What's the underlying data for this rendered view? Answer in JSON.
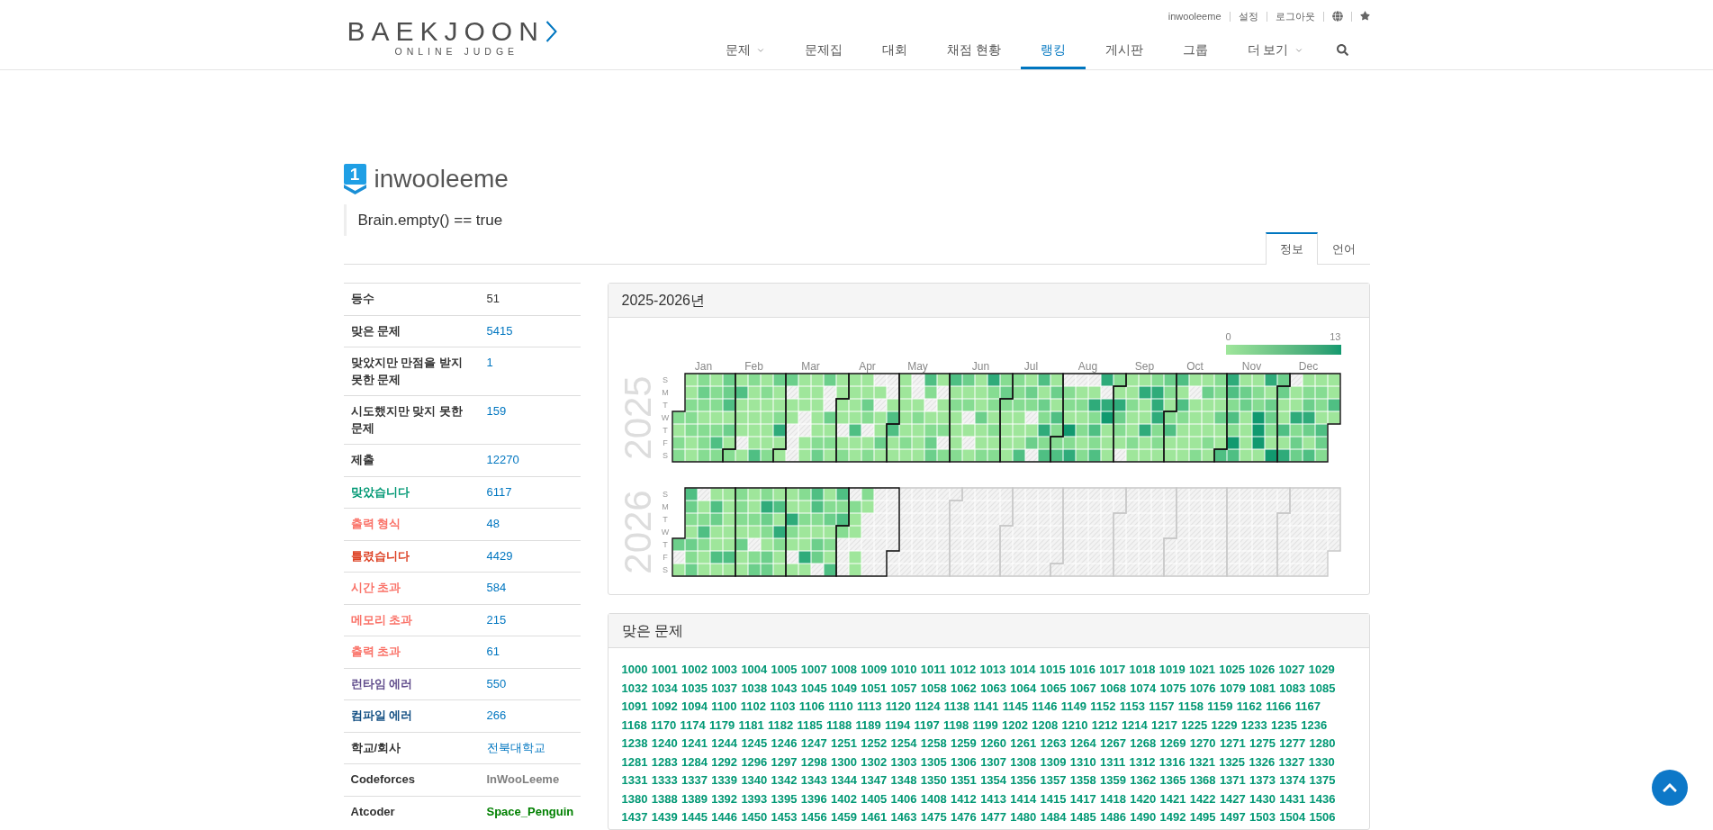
{
  "header": {
    "logo": {
      "wordmark": "BAEKJOON",
      "tagline": "ONLINE JUDGE"
    },
    "user_links": [
      "inwooleeme",
      "설정",
      "로그아웃"
    ],
    "nav": [
      {
        "label": "문제",
        "dropdown": true,
        "selected": false
      },
      {
        "label": "문제집",
        "dropdown": false,
        "selected": false
      },
      {
        "label": "대회",
        "dropdown": false,
        "selected": false
      },
      {
        "label": "채점 현황",
        "dropdown": false,
        "selected": false
      },
      {
        "label": "랭킹",
        "dropdown": false,
        "selected": true
      },
      {
        "label": "게시판",
        "dropdown": false,
        "selected": false
      },
      {
        "label": "그룹",
        "dropdown": false,
        "selected": false
      },
      {
        "label": "더 보기",
        "dropdown": true,
        "selected": false
      }
    ]
  },
  "profile": {
    "rank_badge": "1",
    "username": "inwooleeme",
    "status_message": "Brain.empty() == true",
    "tabs": [
      {
        "label": "정보",
        "selected": true
      },
      {
        "label": "언어",
        "selected": false
      }
    ]
  },
  "stats": [
    {
      "label": {
        "text": "등수",
        "color": "#333333"
      },
      "value": {
        "text": "51",
        "color": "#333333"
      },
      "kind": "plain"
    },
    {
      "label": {
        "text": "맞은 문제",
        "color": "#333333"
      },
      "value": {
        "text": "5415",
        "color": "#0076c0"
      },
      "kind": "link"
    },
    {
      "label": {
        "text": "맞았지만 만점을 받지 못한 문제",
        "color": "#333333"
      },
      "value": {
        "text": "1",
        "color": "#0076c0"
      },
      "kind": "link"
    },
    {
      "label": {
        "text": "시도했지만 맞지 못한 문제",
        "color": "#333333"
      },
      "value": {
        "text": "159",
        "color": "#0076c0"
      },
      "kind": "link"
    },
    {
      "label": {
        "text": "제출",
        "color": "#333333"
      },
      "value": {
        "text": "12270",
        "color": "#0076c0"
      },
      "kind": "link"
    },
    {
      "label": {
        "text": "맞았습니다",
        "color": "#009874"
      },
      "value": {
        "text": "6117",
        "color": "#0076c0"
      },
      "kind": "link"
    },
    {
      "label": {
        "text": "출력 형식",
        "color": "#fa7268"
      },
      "value": {
        "text": "48",
        "color": "#0076c0"
      },
      "kind": "link"
    },
    {
      "label": {
        "text": "틀렸습니다",
        "color": "#dd4124"
      },
      "value": {
        "text": "4429",
        "color": "#0076c0"
      },
      "kind": "link"
    },
    {
      "label": {
        "text": "시간 초과",
        "color": "#fa7268"
      },
      "value": {
        "text": "584",
        "color": "#0076c0"
      },
      "kind": "link"
    },
    {
      "label": {
        "text": "메모리 초과",
        "color": "#fa7268"
      },
      "value": {
        "text": "215",
        "color": "#0076c0"
      },
      "kind": "link"
    },
    {
      "label": {
        "text": "출력 초과",
        "color": "#fa7268"
      },
      "value": {
        "text": "61",
        "color": "#0076c0"
      },
      "kind": "link"
    },
    {
      "label": {
        "text": "런타임 에러",
        "color": "#5f4b8b"
      },
      "value": {
        "text": "550",
        "color": "#0076c0"
      },
      "kind": "link"
    },
    {
      "label": {
        "text": "컴파일 에러",
        "color": "#0f4c81"
      },
      "value": {
        "text": "266",
        "color": "#0076c0"
      },
      "kind": "link"
    },
    {
      "label": {
        "text": "학교/회사",
        "color": "#333333"
      },
      "value": {
        "text": "전북대학교",
        "color": "#0076c0"
      },
      "kind": "link"
    },
    {
      "label": {
        "text": "Codeforces",
        "color": "#333333"
      },
      "value": {
        "text": "InWooLeeme",
        "color": "#808080"
      },
      "kind": "handle"
    },
    {
      "label": {
        "text": "Atcoder",
        "color": "#333333"
      },
      "value": {
        "text": "Space_Penguin",
        "color": "#008000"
      },
      "kind": "handle"
    }
  ],
  "heatmap": {
    "title": "2025-2026년",
    "legend": {
      "min": "0",
      "max": "13"
    },
    "months": [
      "Jan",
      "Feb",
      "Mar",
      "Apr",
      "May",
      "Jun",
      "Jul",
      "Aug",
      "Sep",
      "Oct",
      "Nov",
      "Dec"
    ],
    "years": [
      {
        "label": "2025",
        "weekdays": [
          "S",
          "M",
          "T",
          "W",
          "T",
          "F",
          "S"
        ]
      },
      {
        "label": "2026",
        "weekdays": [
          "S",
          "M",
          "T",
          "W",
          "T",
          "F",
          "S"
        ]
      }
    ]
  },
  "solved": {
    "title": "맞은 문제",
    "problems": [
      "1000",
      "1001",
      "1002",
      "1003",
      "1004",
      "1005",
      "1007",
      "1008",
      "1009",
      "1010",
      "1011",
      "1012",
      "1013",
      "1014",
      "1015",
      "1016",
      "1017",
      "1018",
      "1019",
      "1021",
      "1025",
      "1026",
      "1027",
      "1029",
      "1032",
      "1034",
      "1035",
      "1037",
      "1038",
      "1043",
      "1045",
      "1049",
      "1051",
      "1057",
      "1058",
      "1062",
      "1063",
      "1064",
      "1065",
      "1067",
      "1068",
      "1074",
      "1075",
      "1076",
      "1079",
      "1081",
      "1083",
      "1085",
      "1091",
      "1092",
      "1094",
      "1100",
      "1102",
      "1103",
      "1106",
      "1110",
      "1113",
      "1120",
      "1124",
      "1138",
      "1141",
      "1145",
      "1146",
      "1149",
      "1152",
      "1153",
      "1157",
      "1158",
      "1159",
      "1162",
      "1166",
      "1167",
      "1168",
      "1170",
      "1174",
      "1179",
      "1181",
      "1182",
      "1185",
      "1188",
      "1189",
      "1194",
      "1197",
      "1198",
      "1199",
      "1202",
      "1208",
      "1210",
      "1212",
      "1214",
      "1217",
      "1225",
      "1229",
      "1233",
      "1235",
      "1236",
      "1238",
      "1240",
      "1241",
      "1244",
      "1245",
      "1246",
      "1247",
      "1251",
      "1252",
      "1254",
      "1258",
      "1259",
      "1260",
      "1261",
      "1263",
      "1264",
      "1267",
      "1268",
      "1269",
      "1270",
      "1271",
      "1275",
      "1277",
      "1280",
      "1281",
      "1283",
      "1284",
      "1292",
      "1296",
      "1297",
      "1298",
      "1300",
      "1302",
      "1303",
      "1305",
      "1306",
      "1307",
      "1308",
      "1309",
      "1310",
      "1311",
      "1312",
      "1316",
      "1321",
      "1325",
      "1326",
      "1327",
      "1330",
      "1331",
      "1333",
      "1337",
      "1339",
      "1340",
      "1342",
      "1343",
      "1344",
      "1347",
      "1348",
      "1350",
      "1351",
      "1354",
      "1356",
      "1357",
      "1358",
      "1359",
      "1362",
      "1365",
      "1368",
      "1371",
      "1373",
      "1374",
      "1375",
      "1380",
      "1388",
      "1389",
      "1392",
      "1393",
      "1395",
      "1396",
      "1402",
      "1405",
      "1406",
      "1408",
      "1412",
      "1413",
      "1414",
      "1415",
      "1417",
      "1418",
      "1420",
      "1421",
      "1422",
      "1427",
      "1430",
      "1431",
      "1436",
      "1437",
      "1439",
      "1445",
      "1446",
      "1450",
      "1453",
      "1456",
      "1459",
      "1461",
      "1463",
      "1475",
      "1476",
      "1477",
      "1480",
      "1484",
      "1485",
      "1486",
      "1490",
      "1492",
      "1495",
      "1497",
      "1503",
      "1504",
      "1506"
    ]
  }
}
